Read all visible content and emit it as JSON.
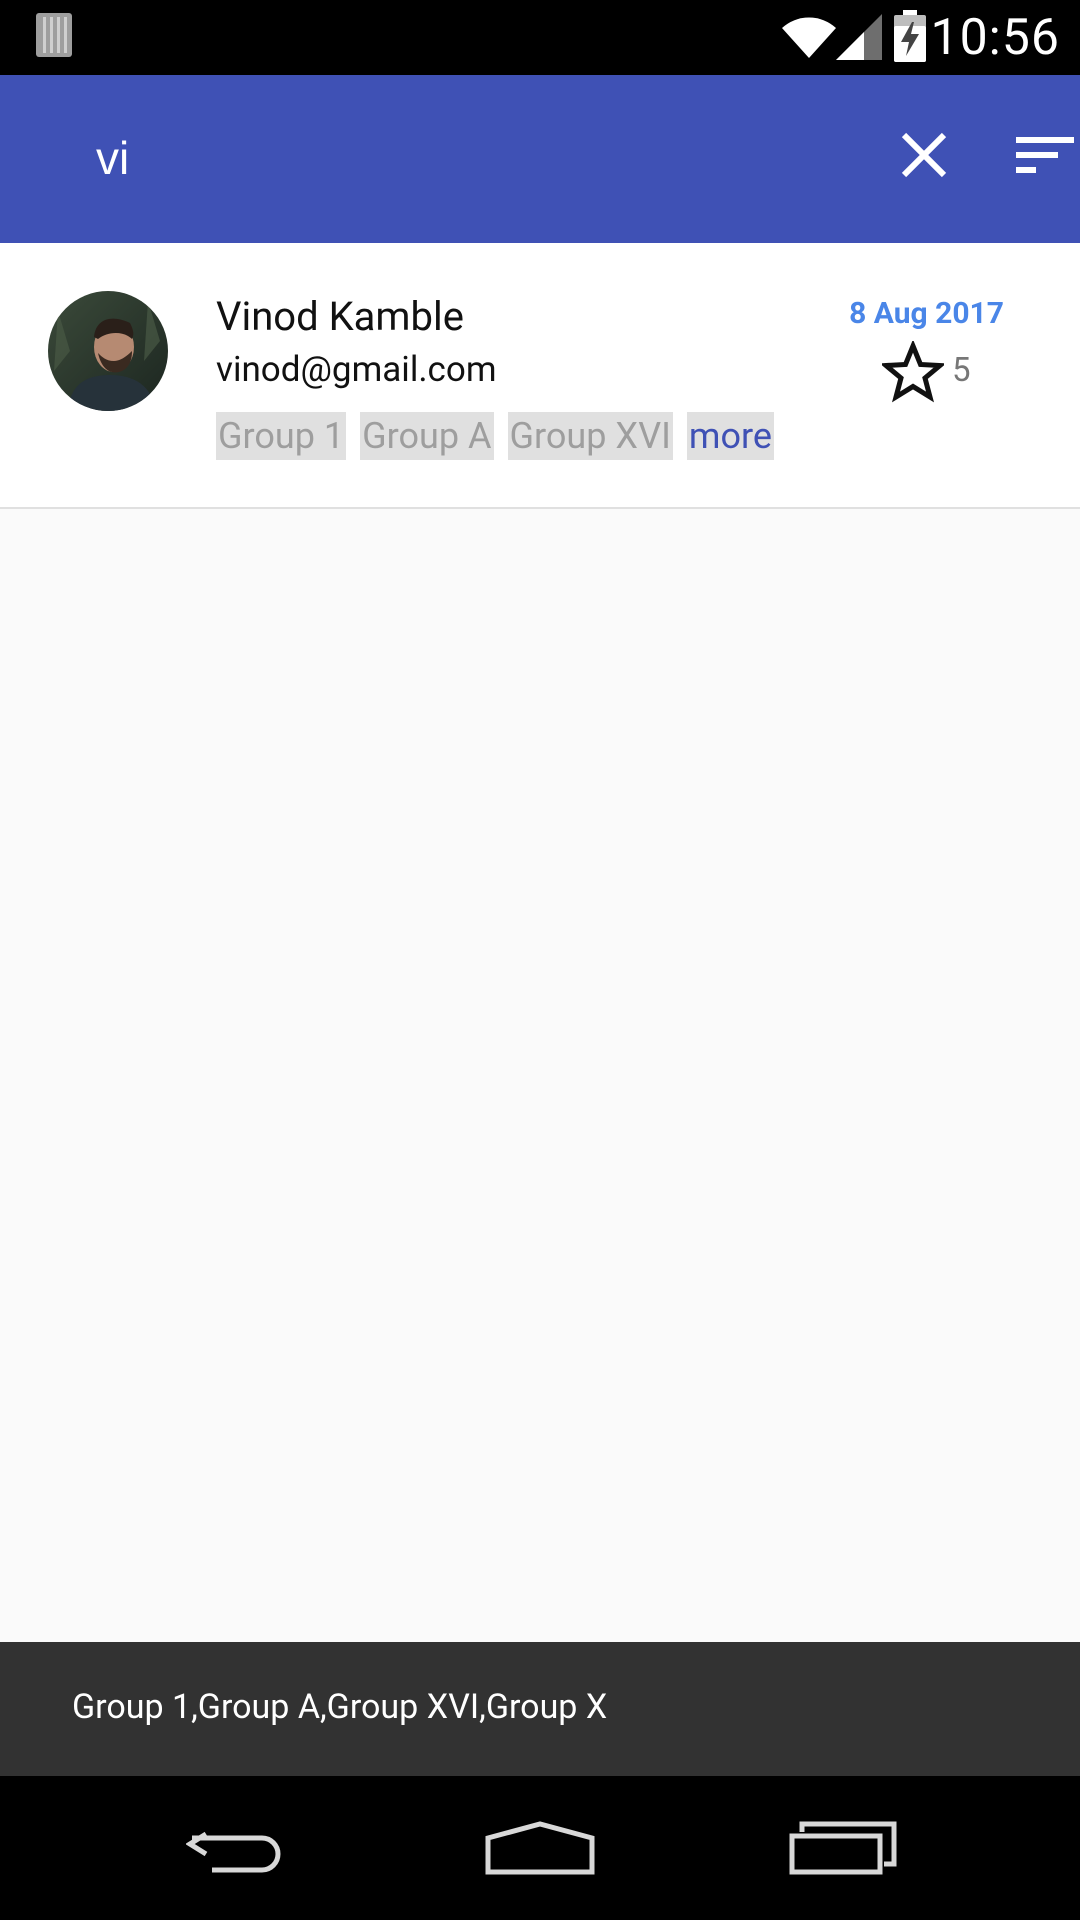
{
  "status_bar": {
    "time": "10:56",
    "icons": [
      "notification-icon",
      "wifi-icon",
      "cell-signal-icon",
      "battery-charging-icon"
    ]
  },
  "toolbar": {
    "search_value": "vi",
    "clear_icon": "close-icon",
    "filter_icon": "filter-list-icon",
    "background_color": "#3f51b5"
  },
  "contact": {
    "name": "Vinod Kamble",
    "email": "vinod@gmail.com",
    "date": "8 Aug 2017",
    "star_count": "5",
    "groups": [
      "Group 1",
      "Group A",
      "Group XVI"
    ],
    "more_label": "more",
    "date_color": "#4a86e8"
  },
  "snackbar": {
    "text": "Group 1,Group A,Group XVI,Group X"
  },
  "nav_bar": {
    "icons": [
      "back-icon",
      "home-icon",
      "recents-icon"
    ]
  }
}
